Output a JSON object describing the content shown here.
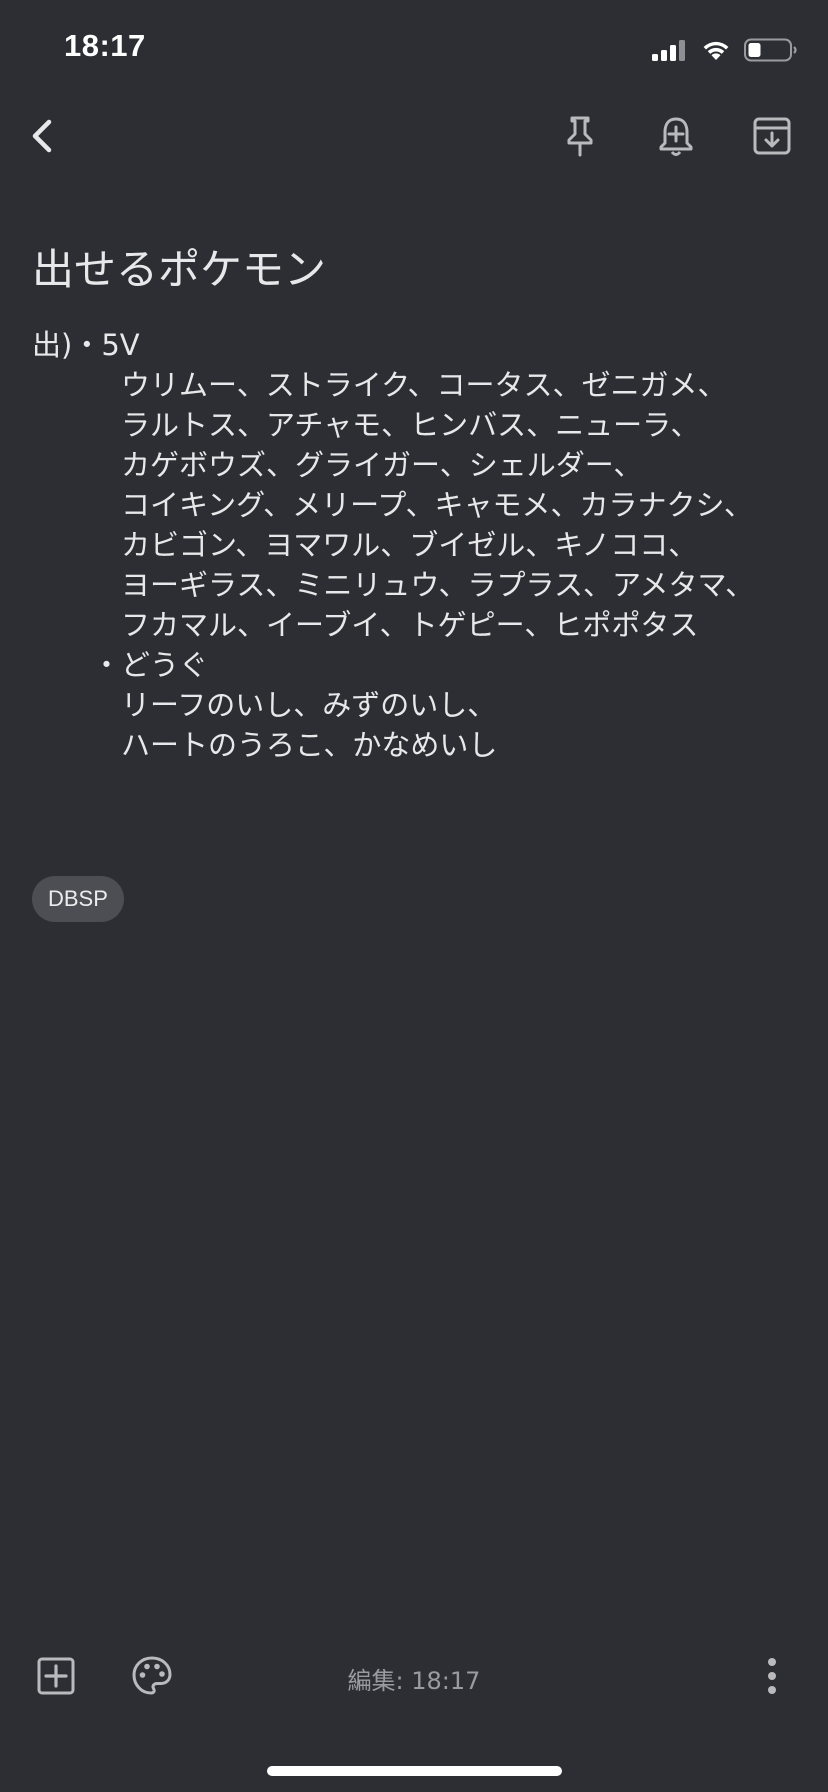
{
  "status_bar": {
    "time": "18:17"
  },
  "toolbar": {
    "back_icon": "chevron-left-icon",
    "pin_icon": "pin-icon",
    "reminder_icon": "bell-plus-icon",
    "archive_icon": "archive-icon"
  },
  "note": {
    "title": "出せるポケモン",
    "lines": [
      "出)・5V",
      "ウリムー、ストライク、コータス、ゼニガメ、",
      "ラルトス、アチャモ、ヒンバス、ニューラ、",
      "カゲボウズ、グライガー、シェルダー、",
      "コイキング、メリープ、キャモメ、カラナクシ、",
      "カビゴン、ヨマワル、ブイゼル、キノココ、",
      "ヨーギラス、ミニリュウ、ラプラス、アメタマ、",
      "フカマル、イーブイ、トゲピー、ヒポポタス",
      "・どうぐ",
      "リーフのいし、みずのいし、",
      "ハートのうろこ、かなめいし"
    ],
    "label": "DBSP"
  },
  "bottom_bar": {
    "edited": "編集: 18:17",
    "add_icon": "add-box-icon",
    "palette_icon": "palette-icon",
    "more_icon": "more-vert-icon"
  },
  "colors": {
    "background": "#2d2e33",
    "text": "#e8e8ea",
    "icon": "#b9b9be",
    "chip": "#4d4e54"
  }
}
